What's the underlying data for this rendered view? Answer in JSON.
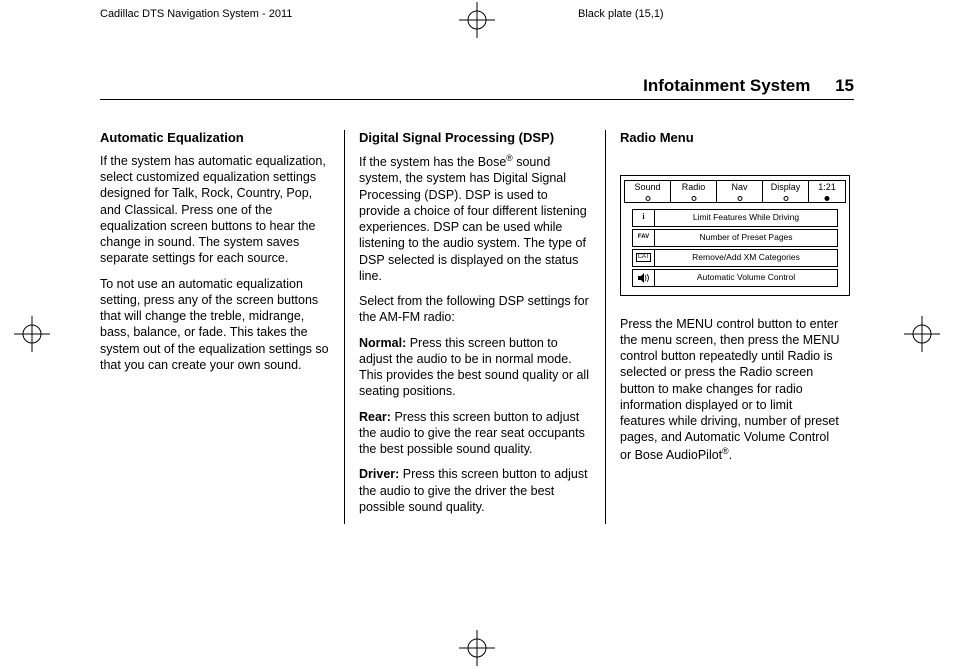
{
  "header": {
    "left": "Cadillac DTS Navigation System - 2011",
    "right": "Black plate (15,1)"
  },
  "page_title": "Infotainment System",
  "page_number": "15",
  "col1": {
    "h": "Automatic Equalization",
    "p1": "If the system has automatic equalization, select customized equalization settings designed for Talk, Rock, Country, Pop, and Classical. Press one of the equalization screen buttons to hear the change in sound. The system saves separate settings for each source.",
    "p2": "To not use an automatic equalization setting, press any of the screen buttons that will change the treble, midrange, bass, balance, or fade. This takes the system out of the equalization settings so that you can create your own sound."
  },
  "col2": {
    "h": "Digital Signal Processing (DSP)",
    "p1a": "If the system has the Bose",
    "p1b": " sound system, the system has Digital Signal Processing (DSP). DSP is used to provide a choice of four different listening experiences. DSP can be used while listening to the audio system. The type of DSP selected is displayed on the status line.",
    "p2": "Select from the following DSP settings for the AM-FM radio:",
    "normal_label": "Normal:",
    "normal_text": "  Press this screen button to adjust the audio to be in normal mode. This provides the best sound quality or all seating positions.",
    "rear_label": "Rear:",
    "rear_text": "  Press this screen button to adjust the audio to give the rear seat occupants the best possible sound quality.",
    "driver_label": "Driver:",
    "driver_text": "  Press this screen button to adjust the audio to give the driver the best possible sound quality."
  },
  "col3": {
    "h": "Radio Menu",
    "tabs": {
      "sound": "Sound",
      "radio": "Radio",
      "nav": "Nav",
      "display": "Display",
      "time": "1:21"
    },
    "rows": {
      "r1_icon": "i",
      "r1": "Limit Features While Driving",
      "r2_icon": "FAV",
      "r2": "Number of Preset Pages",
      "r3_icon": "CAT",
      "r3": "Remove/Add XM Categories",
      "r4": "Automatic Volume Control"
    },
    "p1a": "Press the MENU control button to enter the menu screen, then press the MENU control button repeatedly until Radio is selected or press the Radio screen button to make changes for radio information displayed or to limit features while driving, number of preset pages, and Automatic Volume Control or Bose AudioPilot",
    "p1b": "."
  }
}
